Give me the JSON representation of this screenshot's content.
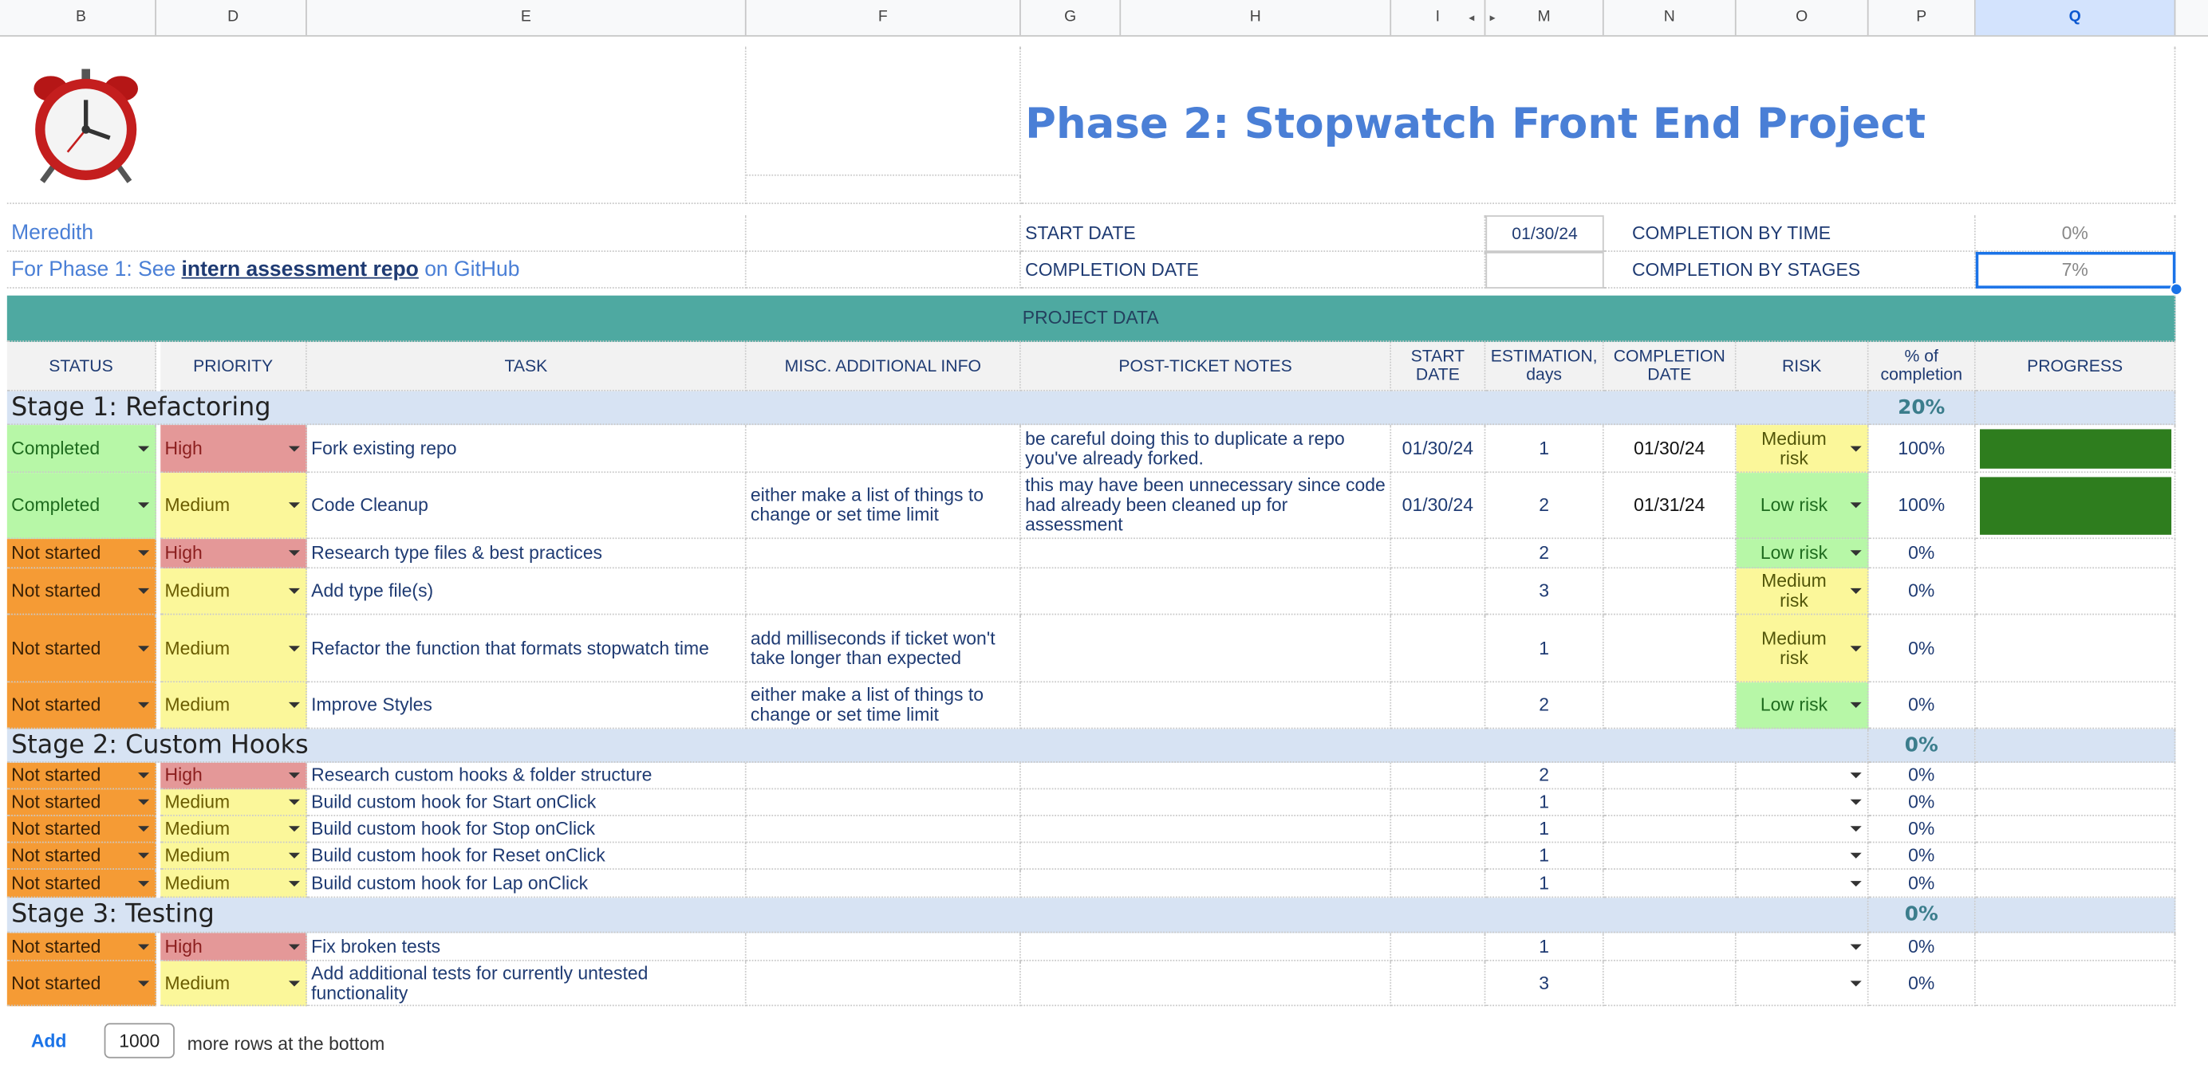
{
  "columns": [
    "B",
    "D",
    "E",
    "F",
    "G",
    "H",
    "I",
    "M",
    "N",
    "O",
    "P",
    "Q"
  ],
  "title": "Phase 2: Stopwatch Front End Project",
  "owner": "Meredith",
  "phase1": {
    "prefix": "For Phase 1: See ",
    "link": "intern assessment repo",
    "suffix": " on GitHub"
  },
  "meta": {
    "start_label": "START DATE",
    "start_value": "01/30/24",
    "completion_label": "COMPLETION DATE",
    "completion_value": "",
    "by_time_label": "COMPLETION BY TIME",
    "by_time_value": "0%",
    "by_stages_label": "COMPLETION BY STAGES",
    "by_stages_value": "7%"
  },
  "banner": "PROJECT DATA",
  "headers": {
    "status": "STATUS",
    "priority": "PRIORITY",
    "task": "TASK",
    "misc": "MISC. ADDITIONAL INFO",
    "notes": "POST-TICKET NOTES",
    "start": "START DATE",
    "est": "ESTIMATION, days",
    "completion": "COMPLETION DATE",
    "risk": "RISK",
    "pct": "% of completion",
    "progress": "PROGRESS"
  },
  "stages": [
    {
      "name": "Stage 1: Refactoring",
      "pct": "20%"
    },
    {
      "name": "Stage 2: Custom Hooks",
      "pct": "0%"
    },
    {
      "name": "Stage 3: Testing",
      "pct": "0%"
    }
  ],
  "tasks": [
    {
      "status": "Completed",
      "priority": "High",
      "task": "Fork existing repo",
      "misc": "",
      "notes": "be careful doing this to duplicate a repo you've already forked.",
      "start": "01/30/24",
      "est": "1",
      "completion": "01/30/24",
      "risk": "Medium risk",
      "pct": "100%",
      "progress": 1.0
    },
    {
      "status": "Completed",
      "priority": "Medium",
      "task": "Code Cleanup",
      "misc": "either make a list of things to change or set time limit",
      "notes": "this may have been unnecessary since code had already been cleaned up for assessment",
      "start": "01/30/24",
      "est": "2",
      "completion": "01/31/24",
      "risk": "Low risk",
      "pct": "100%",
      "progress": 1.0
    },
    {
      "status": "Not started",
      "priority": "High",
      "task": "Research type files & best practices",
      "misc": "",
      "notes": "",
      "start": "",
      "est": "2",
      "completion": "",
      "risk": "Low risk",
      "pct": "0%",
      "progress": 0
    },
    {
      "status": "Not started",
      "priority": "Medium",
      "task": "Add type file(s)",
      "misc": "",
      "notes": "",
      "start": "",
      "est": "3",
      "completion": "",
      "risk": "Medium risk",
      "pct": "0%",
      "progress": 0
    },
    {
      "status": "Not started",
      "priority": "Medium",
      "task": "Refactor the function that formats stopwatch time",
      "misc": "add milliseconds if ticket won't take longer than expected",
      "notes": "",
      "start": "",
      "est": "1",
      "completion": "",
      "risk": "Medium risk",
      "pct": "0%",
      "progress": 0
    },
    {
      "status": "Not started",
      "priority": "Medium",
      "task": "Improve Styles",
      "misc": "either make a list of things to change or set time limit",
      "notes": "",
      "start": "",
      "est": "2",
      "completion": "",
      "risk": "Low risk",
      "pct": "0%",
      "progress": 0
    },
    {
      "status": "Not started",
      "priority": "High",
      "task": "Research custom hooks & folder structure",
      "misc": "",
      "notes": "",
      "start": "",
      "est": "2",
      "completion": "",
      "risk": "",
      "pct": "0%",
      "progress": 0
    },
    {
      "status": "Not started",
      "priority": "Medium",
      "task": "Build custom hook for Start onClick",
      "misc": "",
      "notes": "",
      "start": "",
      "est": "1",
      "completion": "",
      "risk": "",
      "pct": "0%",
      "progress": 0
    },
    {
      "status": "Not started",
      "priority": "Medium",
      "task": "Build custom hook for Stop onClick",
      "misc": "",
      "notes": "",
      "start": "",
      "est": "1",
      "completion": "",
      "risk": "",
      "pct": "0%",
      "progress": 0
    },
    {
      "status": "Not started",
      "priority": "Medium",
      "task": "Build custom hook for Reset onClick",
      "misc": "",
      "notes": "",
      "start": "",
      "est": "1",
      "completion": "",
      "risk": "",
      "pct": "0%",
      "progress": 0
    },
    {
      "status": "Not started",
      "priority": "Medium",
      "task": "Build custom hook for Lap onClick",
      "misc": "",
      "notes": "",
      "start": "",
      "est": "1",
      "completion": "",
      "risk": "",
      "pct": "0%",
      "progress": 0
    },
    {
      "status": "Not started",
      "priority": "High",
      "task": "Fix broken tests",
      "misc": "",
      "notes": "",
      "start": "",
      "est": "1",
      "completion": "",
      "risk": "",
      "pct": "0%",
      "progress": 0
    },
    {
      "status": "Not started",
      "priority": "Medium",
      "task": "Add additional tests for currently untested functionality",
      "misc": "",
      "notes": "",
      "start": "",
      "est": "3",
      "completion": "",
      "risk": "",
      "pct": "0%",
      "progress": 0
    }
  ],
  "footer": {
    "add_label": "Add",
    "rows_value": "1000",
    "rows_suffix": "more rows at the bottom"
  },
  "colors": {
    "completed": "#b7f7a7",
    "not_started": "#f59b35",
    "high": "#e49898",
    "medium": "#fbf79a",
    "banner": "#4ea9a1",
    "stage": "#d7e3f3",
    "progress": "#2e7d1e",
    "title": "#4a7fd6"
  },
  "icons": {
    "logo": "alarm-clock-icon"
  }
}
